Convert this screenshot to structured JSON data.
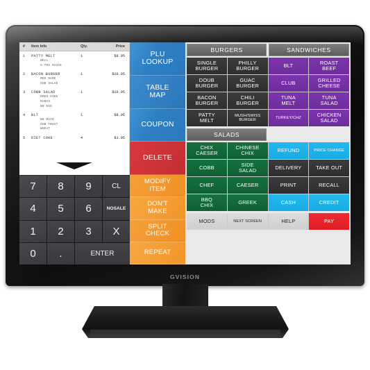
{
  "device": {
    "brand": "GVISION"
  },
  "receipt": {
    "columns": [
      "#",
      "Item Info",
      "Qty.",
      "Price"
    ],
    "items": [
      {
        "no": "1",
        "name": "PATTY MELT",
        "qty": "1",
        "price": "$9.95",
        "mods": [
          "WELL",
          "X-TRA SAUCE"
        ]
      },
      {
        "no": "2",
        "name": "BACON BURGER",
        "qty": "1",
        "price": "$10.95",
        "mods": [
          "MED RARE",
          "SUB SALAD"
        ]
      },
      {
        "no": "3",
        "name": "COBB SALAD",
        "qty": "1",
        "price": "$10.95",
        "mods": [
          "DRES SIDE",
          "RANCH",
          "NO EGG"
        ]
      },
      {
        "no": "4",
        "name": "BLT",
        "qty": "1",
        "price": "$8.95",
        "mods": [
          "NO MAYO",
          "SUB FRUIT",
          "WHEAT"
        ]
      },
      {
        "no": "5",
        "name": "DIET COKE",
        "qty": "4",
        "price": "$1.95",
        "mods": []
      }
    ],
    "scroll_icon": "scroll-down-arrow"
  },
  "keypad": {
    "keys": [
      {
        "label": "7",
        "style": "num"
      },
      {
        "label": "8",
        "style": "num"
      },
      {
        "label": "9",
        "style": "num"
      },
      {
        "label": "CL",
        "style": "md"
      },
      {
        "label": "4",
        "style": "num"
      },
      {
        "label": "5",
        "style": "num"
      },
      {
        "label": "6",
        "style": "num"
      },
      {
        "label": "NO\nSALE",
        "style": "sm"
      },
      {
        "label": "1",
        "style": "num"
      },
      {
        "label": "2",
        "style": "num"
      },
      {
        "label": "3",
        "style": "num"
      },
      {
        "label": "X",
        "style": "num"
      },
      {
        "label": "0",
        "style": "num"
      },
      {
        "label": ".",
        "style": "num"
      },
      {
        "label": "ENTER",
        "style": "enter"
      }
    ]
  },
  "functions": {
    "top": [
      {
        "label": "PLU\nLOOKUP",
        "color": "blue"
      },
      {
        "label": "TABLE\nMAP",
        "color": "blue2"
      },
      {
        "label": "COUPON",
        "color": "blue"
      },
      {
        "label": "DELETE",
        "color": "red"
      }
    ],
    "bottom": [
      {
        "label": "MODIFY\nITEM",
        "color": "orange"
      },
      {
        "label": "DON'T\nMAKE",
        "color": "orange2"
      },
      {
        "label": "SPLIT\nCHECK",
        "color": "orange"
      },
      {
        "label": "REPEAT",
        "color": "orange2"
      }
    ]
  },
  "menu": {
    "categories_top": [
      "BURGERS",
      "SANDWICHES"
    ],
    "category_salads": "SALADS",
    "grid_top": [
      {
        "label": "SINGLE\nBURGER",
        "color": "dark"
      },
      {
        "label": "PHILLY\nBURGER",
        "color": "dark"
      },
      {
        "label": "BLT",
        "color": "purple"
      },
      {
        "label": "ROAST\nBEEF",
        "color": "purple"
      },
      {
        "label": "DOUB\nBURGER",
        "color": "dark"
      },
      {
        "label": "GUAC\nBURGER",
        "color": "dark"
      },
      {
        "label": "CLUB",
        "color": "purple"
      },
      {
        "label": "GRILLED\nCHEESE",
        "color": "purple"
      },
      {
        "label": "BACON\nBURGER",
        "color": "dark"
      },
      {
        "label": "CHILI\nBURGER",
        "color": "dark"
      },
      {
        "label": "TUNA\nMELT",
        "color": "purple"
      },
      {
        "label": "TUNA\nSALAD",
        "color": "purple"
      },
      {
        "label": "PATTY\nMELT",
        "color": "dark"
      },
      {
        "label": "MUSH/SWISS\nBURGER",
        "color": "dark",
        "size": "tiny"
      },
      {
        "label": "TURKEY/CHZ",
        "color": "purple",
        "size": "tiny"
      },
      {
        "label": "CHICKEN\nSALAD",
        "color": "purple"
      }
    ],
    "grid_bottom": [
      {
        "label": "CHIX\nCAESER",
        "color": "green"
      },
      {
        "label": "CHINESE\nCHIX",
        "color": "green"
      },
      {
        "label": "REFUND",
        "color": "cyan"
      },
      {
        "label": "PRICE CHANGE",
        "color": "cyan",
        "size": "tiny"
      },
      {
        "label": "COBB",
        "color": "green"
      },
      {
        "label": "SIDE\nSALAD",
        "color": "green"
      },
      {
        "label": "DELIVERY",
        "color": "dark"
      },
      {
        "label": "TAKE OUT",
        "color": "dark"
      },
      {
        "label": "CHEF",
        "color": "green"
      },
      {
        "label": "CAESER",
        "color": "green"
      },
      {
        "label": "PRINT",
        "color": "dark"
      },
      {
        "label": "RECALL",
        "color": "dark"
      },
      {
        "label": "BBQ\nCHIX",
        "color": "green"
      },
      {
        "label": "GREEK",
        "color": "green"
      },
      {
        "label": "CASH",
        "color": "cyan"
      },
      {
        "label": "CREDIT",
        "color": "cyan"
      }
    ],
    "action_row": [
      {
        "label": "MODS",
        "color": "lgray"
      },
      {
        "label": "NEXT SCREEN",
        "color": "lgray",
        "size": "tiny"
      },
      {
        "label": "HELP",
        "color": "lgray"
      },
      {
        "label": "PAY",
        "color": "redbtn"
      }
    ]
  },
  "colors": {
    "blue": "#2f7fc4",
    "red": "#d8373c",
    "orange": "#f09528",
    "purple": "#7d34ae",
    "green": "#15713e",
    "cyan": "#24b8ef",
    "dark": "#3b3b3d",
    "pay_red": "#ee2a32"
  }
}
